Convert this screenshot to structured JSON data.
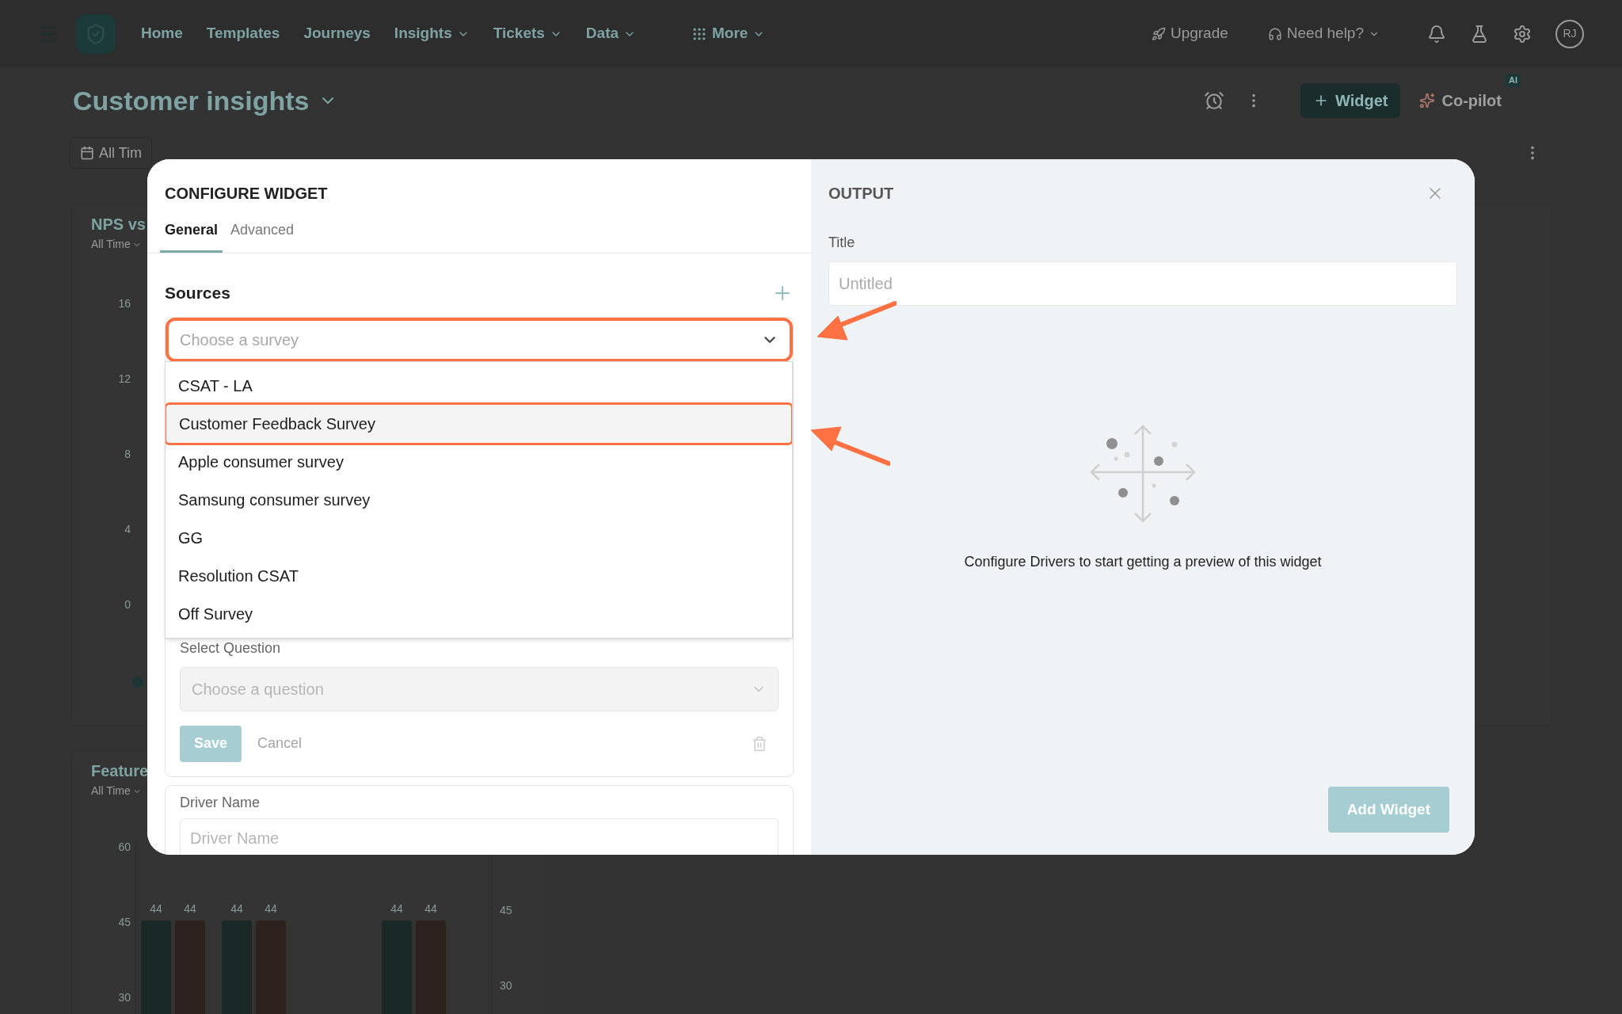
{
  "nav": {
    "items": [
      {
        "label": "Home",
        "caret": false
      },
      {
        "label": "Templates",
        "caret": false
      },
      {
        "label": "Journeys",
        "caret": false
      },
      {
        "label": "Insights",
        "caret": true
      },
      {
        "label": "Tickets",
        "caret": true
      },
      {
        "label": "Data",
        "caret": true
      },
      {
        "label": "More",
        "caret": true
      }
    ],
    "upgrade": "Upgrade",
    "help": "Need help?",
    "avatar": "RJ"
  },
  "page": {
    "title": "Customer insights",
    "widget_button": "Widget",
    "copilot": "Co-pilot",
    "copilot_badge": "AI",
    "date_filter": "All Tim"
  },
  "cards": [
    {
      "title": "NPS vs",
      "filter": "All Time",
      "ticks": [
        "16",
        "12",
        "8",
        "4",
        "0"
      ]
    },
    {
      "title": "Feature",
      "filter": "All Time",
      "ticks": [
        "60",
        "45",
        "30"
      ],
      "right_ticks": [
        "45",
        "30"
      ],
      "value_labels": [
        "44",
        "44",
        "44",
        "44",
        "44",
        "44"
      ]
    }
  ],
  "modal": {
    "title": "CONFIGURE WIDGET",
    "tabs": [
      {
        "label": "General",
        "selected": true
      },
      {
        "label": "Advanced",
        "selected": false
      }
    ],
    "sources_label": "Sources",
    "survey_select": {
      "placeholder": "Choose a survey",
      "annotated": true
    },
    "options": [
      {
        "label": "CSAT - LA",
        "highlighted": false
      },
      {
        "label": "Customer Feedback Survey",
        "highlighted": true
      },
      {
        "label": "Apple consumer survey",
        "highlighted": false
      },
      {
        "label": "Samsung consumer survey",
        "highlighted": false
      },
      {
        "label": "GG",
        "highlighted": false
      },
      {
        "label": "Resolution CSAT",
        "highlighted": false
      },
      {
        "label": "Off Survey",
        "highlighted": false
      }
    ],
    "question_label": "Select Question",
    "question_placeholder": "Choose a question",
    "save": "Save",
    "cancel": "Cancel",
    "driver_label": "Driver Name",
    "driver_placeholder": "Driver Name",
    "output": {
      "title": "OUTPUT",
      "title_label": "Title",
      "title_placeholder": "Untitled",
      "empty_message": "Configure Drivers to start getting a preview of this widget",
      "add_button": "Add Widget"
    }
  }
}
